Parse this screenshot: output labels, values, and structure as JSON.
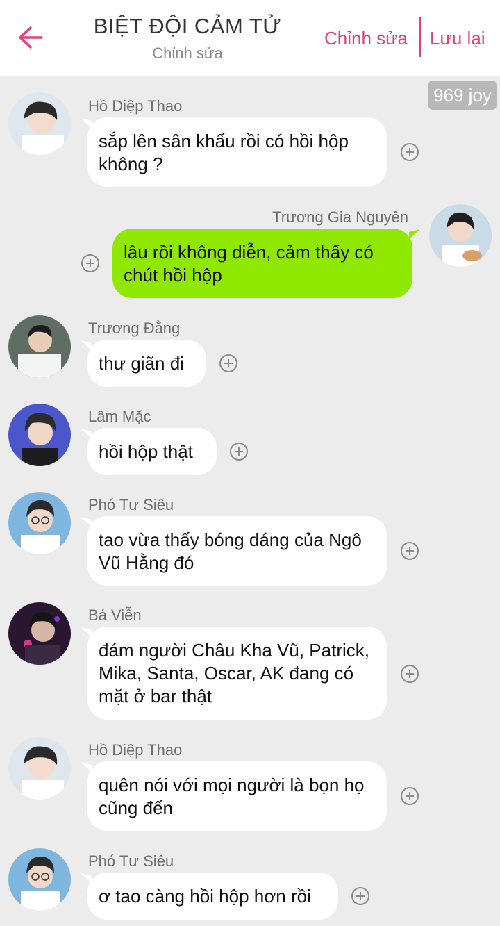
{
  "header": {
    "title": "BIỆT ĐỘI CẢM TỬ",
    "subtitle": "Chỉnh sửa",
    "edit_label": "Chỉnh sửa",
    "save_label": "Lưu lại",
    "accent_color": "#e0427f"
  },
  "watermark": "969 joy",
  "messages": [
    {
      "sender": "Hồ Diệp Thao",
      "text": "sắp lên sân khấu rồi có hồi hộp không ?",
      "side": "left"
    },
    {
      "sender": "Trương Gia Nguyên",
      "text": "lâu rồi không diễn, cảm thấy có chút hồi hộp",
      "side": "right",
      "bubble_color": "#8fe800"
    },
    {
      "sender": "Trương Đằng",
      "text": "thư giãn đi",
      "side": "left"
    },
    {
      "sender": "Lâm Mặc",
      "text": "hồi hộp thật",
      "side": "left"
    },
    {
      "sender": "Phó Tư Siêu",
      "text": "tao vừa thấy bóng dáng của Ngô Vũ Hằng đó",
      "side": "left"
    },
    {
      "sender": "Bá Viễn",
      "text": "đám người Châu Kha Vũ, Patrick, Mika, Santa, Oscar, AK đang có mặt ở bar thật",
      "side": "left"
    },
    {
      "sender": "Hồ Diệp Thao",
      "text": "quên nói với mọi người là bọn họ cũng đến",
      "side": "left"
    },
    {
      "sender": "Phó Tư Siêu",
      "text": "ơ tao càng hồi hộp hơn rồi",
      "side": "left"
    }
  ],
  "icons": {
    "back": "arrow-left-icon",
    "add": "plus-circle-icon",
    "avatar": "avatar"
  }
}
